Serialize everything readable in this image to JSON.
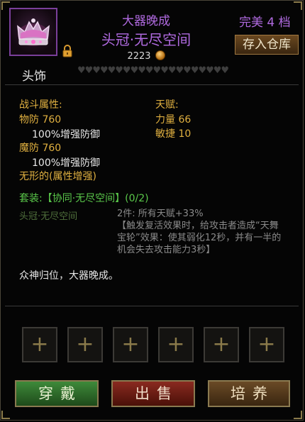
{
  "header": {
    "top_title": "大器晚成",
    "item_name": "头冠·无尽空间",
    "price": "2223",
    "quality": "完美 4 档",
    "store_button": "存入仓库"
  },
  "slot": {
    "type": "头饰",
    "hearts": "♥♥♥♥♥♥♥♥♥♥♥♥♥♥♥♥♥♥♥♥"
  },
  "combat": {
    "title": "战斗属性:",
    "phys_def": "物防 760",
    "phys_def_sub": "100%增强防御",
    "mag_def": "魔防 760",
    "mag_def_sub": "100%增强防御",
    "formless": "无形的(属性增强)"
  },
  "talent": {
    "title": "天赋:",
    "str": "力量 66",
    "agi": "敏捷 10"
  },
  "set": {
    "title": "套装:【协同·无尽空间】(0/2)",
    "piece": "头冠·无尽空间",
    "bonus_line1": "2件: 所有天赋+33%",
    "bonus_line2": "【触发复活效果时，给攻击者造成“天舞宝轮”效果：使其弱化12秒，并有一半的机会失去攻击能力3秒】"
  },
  "description": "众神归位，大器晚成。",
  "gem_slots": [
    "+",
    "+",
    "+",
    "+",
    "+",
    "+"
  ],
  "actions": {
    "wear": "穿戴",
    "sell": "出售",
    "train": "培养"
  }
}
